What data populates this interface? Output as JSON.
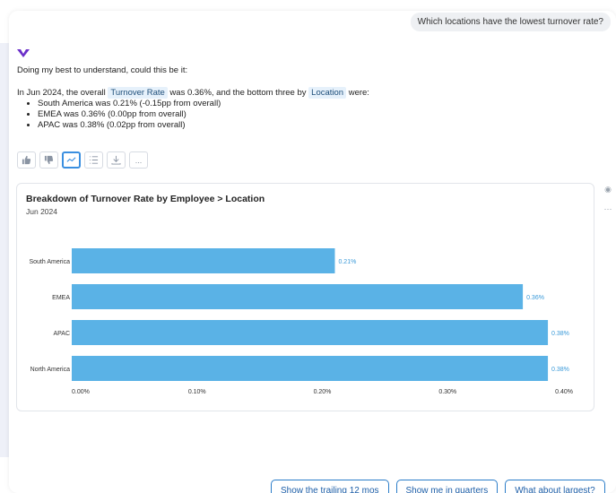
{
  "user_message": "Which locations have the lowest turnover rate?",
  "assistant": {
    "intro": "Doing my best to understand, could this be it:",
    "summary": {
      "prefix": "In Jun 2024, the overall ",
      "metric_chip": "Turnover Rate",
      "middle": " was 0.36%, and the bottom three by ",
      "dimension_chip": "Location",
      "suffix": " were:"
    },
    "findings": [
      "South America was 0.21% (-0.15pp from overall)",
      "EMEA was 0.36% (0.00pp from overall)",
      "APAC was 0.38% (0.02pp from overall)"
    ]
  },
  "actions": {
    "thumbs_up": "thumbs-up-icon",
    "thumbs_down": "thumbs-down-icon",
    "chart": "line-chart-icon",
    "list": "list-icon",
    "download": "download-icon",
    "more": "..."
  },
  "chart_card": {
    "title": "Breakdown of Turnover Rate by Employee > Location",
    "subtitle": "Jun 2024"
  },
  "chart_data": {
    "type": "bar",
    "orientation": "horizontal",
    "categories": [
      "South America",
      "EMEA",
      "APAC",
      "North America"
    ],
    "values": [
      0.21,
      0.36,
      0.38,
      0.38
    ],
    "value_labels": [
      "0.21%",
      "0.36%",
      "0.38%",
      "0.38%"
    ],
    "x_ticks": [
      "0.00%",
      "0.10%",
      "0.20%",
      "0.30%",
      "0.40%"
    ],
    "xlim": [
      0,
      0.4
    ],
    "bar_color": "#5ab2e6",
    "label_color": "#3a9ad9",
    "grid": false
  },
  "suggestions": [
    "Show the trailing 12 mos",
    "Show me in quarters",
    "What about largest?"
  ],
  "colors": {
    "accent": "#2b7dc9",
    "logo": "#6b2fc9",
    "chip_bg": "#e6f1fb"
  }
}
